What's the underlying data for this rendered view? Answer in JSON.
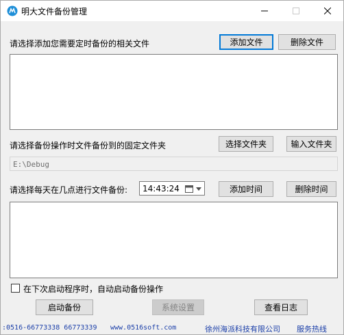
{
  "window": {
    "title": "明大文件备份管理",
    "icons": {
      "app": "app-icon",
      "minimize": "minimize-icon",
      "maximize": "maximize-icon",
      "close": "close-icon"
    }
  },
  "files": {
    "prompt": "请选择添加您需要定时备份的相关文件",
    "add_label": "添加文件",
    "delete_label": "删除文件",
    "items": []
  },
  "folder": {
    "prompt": "请选择备份操作时文件备份到的固定文件夹",
    "choose_label": "选择文件夹",
    "input_label": "输入文件夹",
    "path": "E:\\Debug"
  },
  "schedule": {
    "prompt": "请选择每天在几点进行文件备份:",
    "time": "14:43:24",
    "add_time_label": "添加时间",
    "delete_time_label": "删除时间",
    "items": []
  },
  "options": {
    "autostart_label": "在下次启动程序时，自动启动备份操作",
    "autostart_checked": false
  },
  "actions": {
    "start_label": "启动备份",
    "settings_label": "系统设置",
    "log_label": "查看日志"
  },
  "footer": {
    "phones": ":0516-66773338 66773339",
    "website": "www.0516soft.com",
    "company": "徐州海派科技有限公司",
    "hotline": "服务热线"
  },
  "colors": {
    "accent": "#0078d7",
    "link": "#1a3ea8",
    "background": "#f0f0f0"
  }
}
